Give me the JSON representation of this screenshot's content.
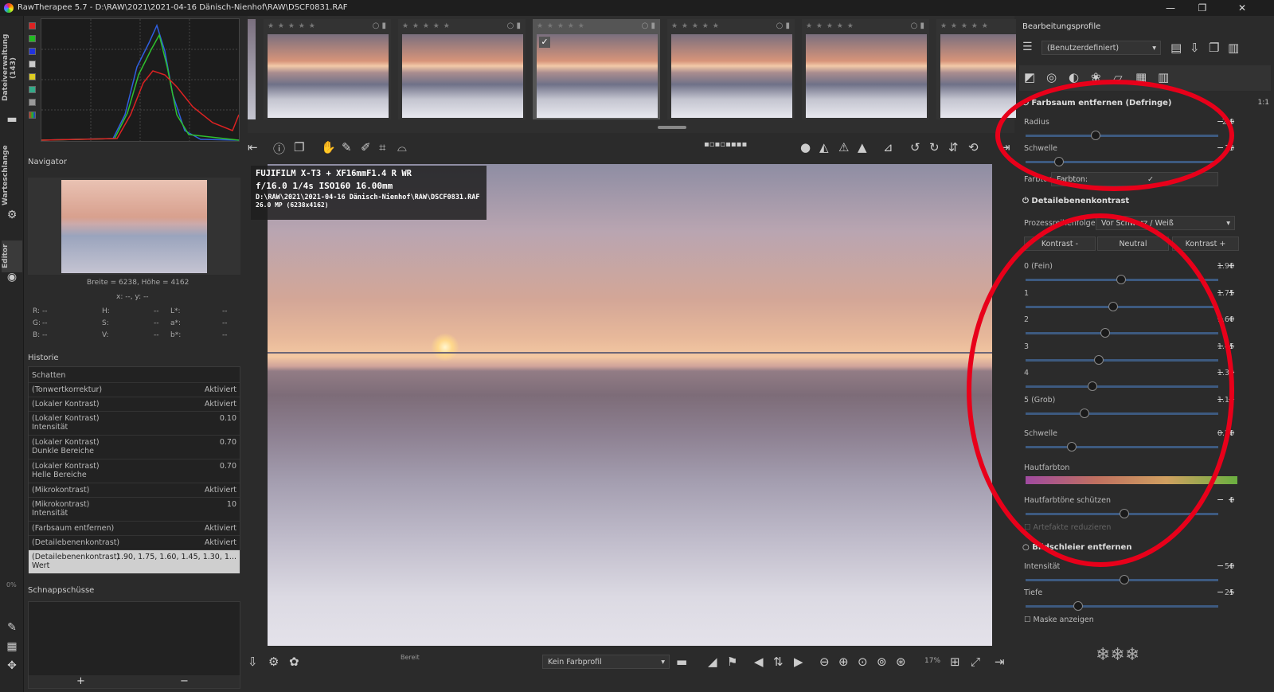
{
  "window": {
    "title": "RawTherapee 5.7 - D:\\RAW\\2021\\2021-04-16 Dänisch-Nienhof\\RAW\\DSCF0831.RAF",
    "min": "—",
    "max": "❐",
    "close": "✕"
  },
  "left_tabs": {
    "file_browser": "Dateiverwaltung (143)",
    "queue": "Warteschlange",
    "editor": "Editor"
  },
  "navigator": {
    "title": "Navigator",
    "dims": "Breite = 6238, Höhe = 4162",
    "coords": "x: --, y: --",
    "rows": [
      [
        "R:",
        "--",
        "H:",
        "--",
        "L*:",
        "--"
      ],
      [
        "G:",
        "--",
        "S:",
        "--",
        "a*:",
        "--"
      ],
      [
        "B:",
        "--",
        "V:",
        "--",
        "b*:",
        "--"
      ]
    ]
  },
  "history": {
    "title": "Historie",
    "rows": [
      {
        "name": "Schatten",
        "value": ""
      },
      {
        "name": "(Tonwertkorrektur)",
        "value": "Aktiviert"
      },
      {
        "name": "(Lokaler Kontrast)",
        "value": "Aktiviert"
      },
      {
        "name": "(Lokaler Kontrast)\nIntensität",
        "value": "0.10"
      },
      {
        "name": "(Lokaler Kontrast)\nDunkle Bereiche",
        "value": "0.70"
      },
      {
        "name": "(Lokaler Kontrast)\nHelle Bereiche",
        "value": "0.70"
      },
      {
        "name": "(Mikrokontrast)",
        "value": "Aktiviert"
      },
      {
        "name": "(Mikrokontrast)\nIntensität",
        "value": "10"
      },
      {
        "name": "(Farbsaum entfernen)",
        "value": "Aktiviert"
      },
      {
        "name": "(Detailebenenkontrast)",
        "value": "Aktiviert"
      },
      {
        "name": "(Detailebenenkontrast)\nWert",
        "value": "1.90, 1.75, 1.60, 1.45, 1.30, 1..."
      }
    ]
  },
  "snapshots": {
    "title": "Schnappschüsse",
    "add": "+",
    "remove": "−",
    "progress": "0%"
  },
  "filmstrip": {
    "stars": "★ ★ ★ ★ ★",
    "count": 6
  },
  "exif": {
    "camera": "FUJIFILM X-T3 + XF16mmF1.4 R WR",
    "exposure": "f/16.0  1/4s  ISO160  16.00mm",
    "path": "D:\\RAW\\2021\\2021-04-16 Dänisch-Nienhof\\RAW\\DSCF0831.RAF",
    "size": "26.0 MP (6238x4162)"
  },
  "bottombar": {
    "status": "Bereit",
    "profile": "Kein Farbprofil",
    "zoom": "17%"
  },
  "right": {
    "profiles_title": "Bearbeitungsprofile",
    "profile_value": "(Benutzerdefiniert)",
    "defringe": {
      "title": "Farbsaum entfernen (Defringe)",
      "radius_label": "Radius",
      "radius": "2.0",
      "threshold_label": "Schwelle",
      "threshold": "13",
      "hue_label": "Farbton:",
      "hue_prefix": "Farbton:"
    },
    "cbdl": {
      "title": "Detailebenenkontrast",
      "order_label": "Prozessreihenfolge:",
      "order_value": "Vor Schwarz / Weiß",
      "btn_minus": "Kontrast -",
      "btn_neutral": "Neutral",
      "btn_plus": "Kontrast +",
      "levels": [
        {
          "label": "0 (Fein)",
          "value": "1.90"
        },
        {
          "label": "1",
          "value": "1.75"
        },
        {
          "label": "2",
          "value": "1.60"
        },
        {
          "label": "3",
          "value": "1.45"
        },
        {
          "label": "4",
          "value": "1.30"
        },
        {
          "label": "5 (Grob)",
          "value": "1.15"
        }
      ],
      "threshold_label": "Schwelle",
      "threshold": "0.20",
      "skin_label": "Hautfarbton",
      "skin_protect_label": "Hautfarbtöne schützen",
      "skin_protect": "0",
      "artifacts_label": "Artefakte reduzieren"
    },
    "haze": {
      "title": "Bildschleier entfernen",
      "intensity_label": "Intensität",
      "intensity": "50",
      "depth_label": "Tiefe",
      "depth": "25",
      "mask_label": "Maske anzeigen"
    },
    "ratio": "1:1"
  },
  "colors": {
    "highlight": "#e8001a",
    "slider": "#3d5a80"
  }
}
